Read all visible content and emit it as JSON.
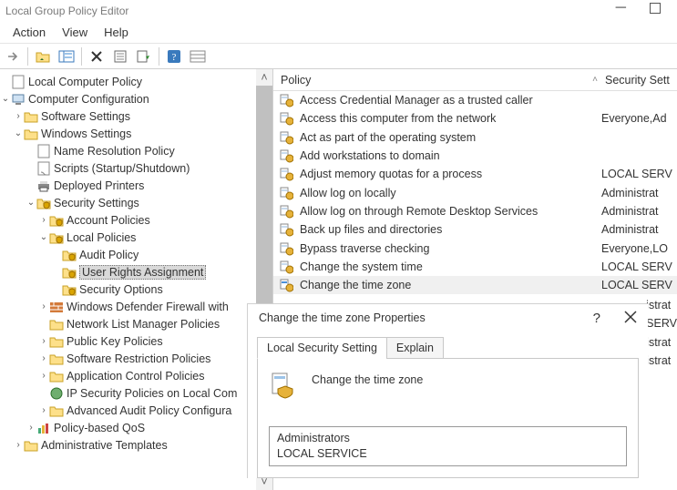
{
  "window": {
    "title": "Local Group Policy Editor"
  },
  "menu": {
    "action": "Action",
    "view": "View",
    "help": "Help"
  },
  "tree": {
    "root": "Local Computer Policy",
    "computer_config": "Computer Configuration",
    "software": "Software Settings",
    "windows": "Windows Settings",
    "name_res": "Name Resolution Policy",
    "scripts": "Scripts (Startup/Shutdown)",
    "printers": "Deployed Printers",
    "security": "Security Settings",
    "account": "Account Policies",
    "localpol": "Local Policies",
    "audit": "Audit Policy",
    "ura": "User Rights Assignment",
    "secopt": "Security Options",
    "wdf": "Windows Defender Firewall with",
    "nlmp": "Network List Manager Policies",
    "pkp": "Public Key Policies",
    "srp": "Software Restriction Policies",
    "acp": "Application Control Policies",
    "ipsec": "IP Security Policies on Local Com",
    "aapc": "Advanced Audit Policy Configura",
    "pbq": "Policy-based QoS",
    "admintmpl": "Administrative Templates"
  },
  "columns": {
    "policy": "Policy",
    "sec": "Security Sett"
  },
  "policies": [
    {
      "name": "Access Credential Manager as a trusted caller",
      "sec": ""
    },
    {
      "name": "Access this computer from the network",
      "sec": "Everyone,Ad"
    },
    {
      "name": "Act as part of the operating system",
      "sec": ""
    },
    {
      "name": "Add workstations to domain",
      "sec": ""
    },
    {
      "name": "Adjust memory quotas for a process",
      "sec": "LOCAL SERV"
    },
    {
      "name": "Allow log on locally",
      "sec": "Administrat"
    },
    {
      "name": "Allow log on through Remote Desktop Services",
      "sec": "Administrat"
    },
    {
      "name": "Back up files and directories",
      "sec": "Administrat"
    },
    {
      "name": "Bypass traverse checking",
      "sec": "Everyone,LO"
    },
    {
      "name": "Change the system time",
      "sec": "LOCAL SERV"
    },
    {
      "name": "Change the time zone",
      "sec": "LOCAL SERV",
      "sel": true
    }
  ],
  "hidden_rows": [
    {
      "sec": "istrat"
    },
    {
      "sec": "SERV"
    },
    {
      "sec": "istrat"
    },
    {
      "sec": "istrat"
    }
  ],
  "dialog": {
    "title": "Change the time zone Properties",
    "help": "?",
    "tab1": "Local Security Setting",
    "tab2": "Explain",
    "heading": "Change the time zone",
    "users": "Administrators\nLOCAL SERVICE"
  }
}
